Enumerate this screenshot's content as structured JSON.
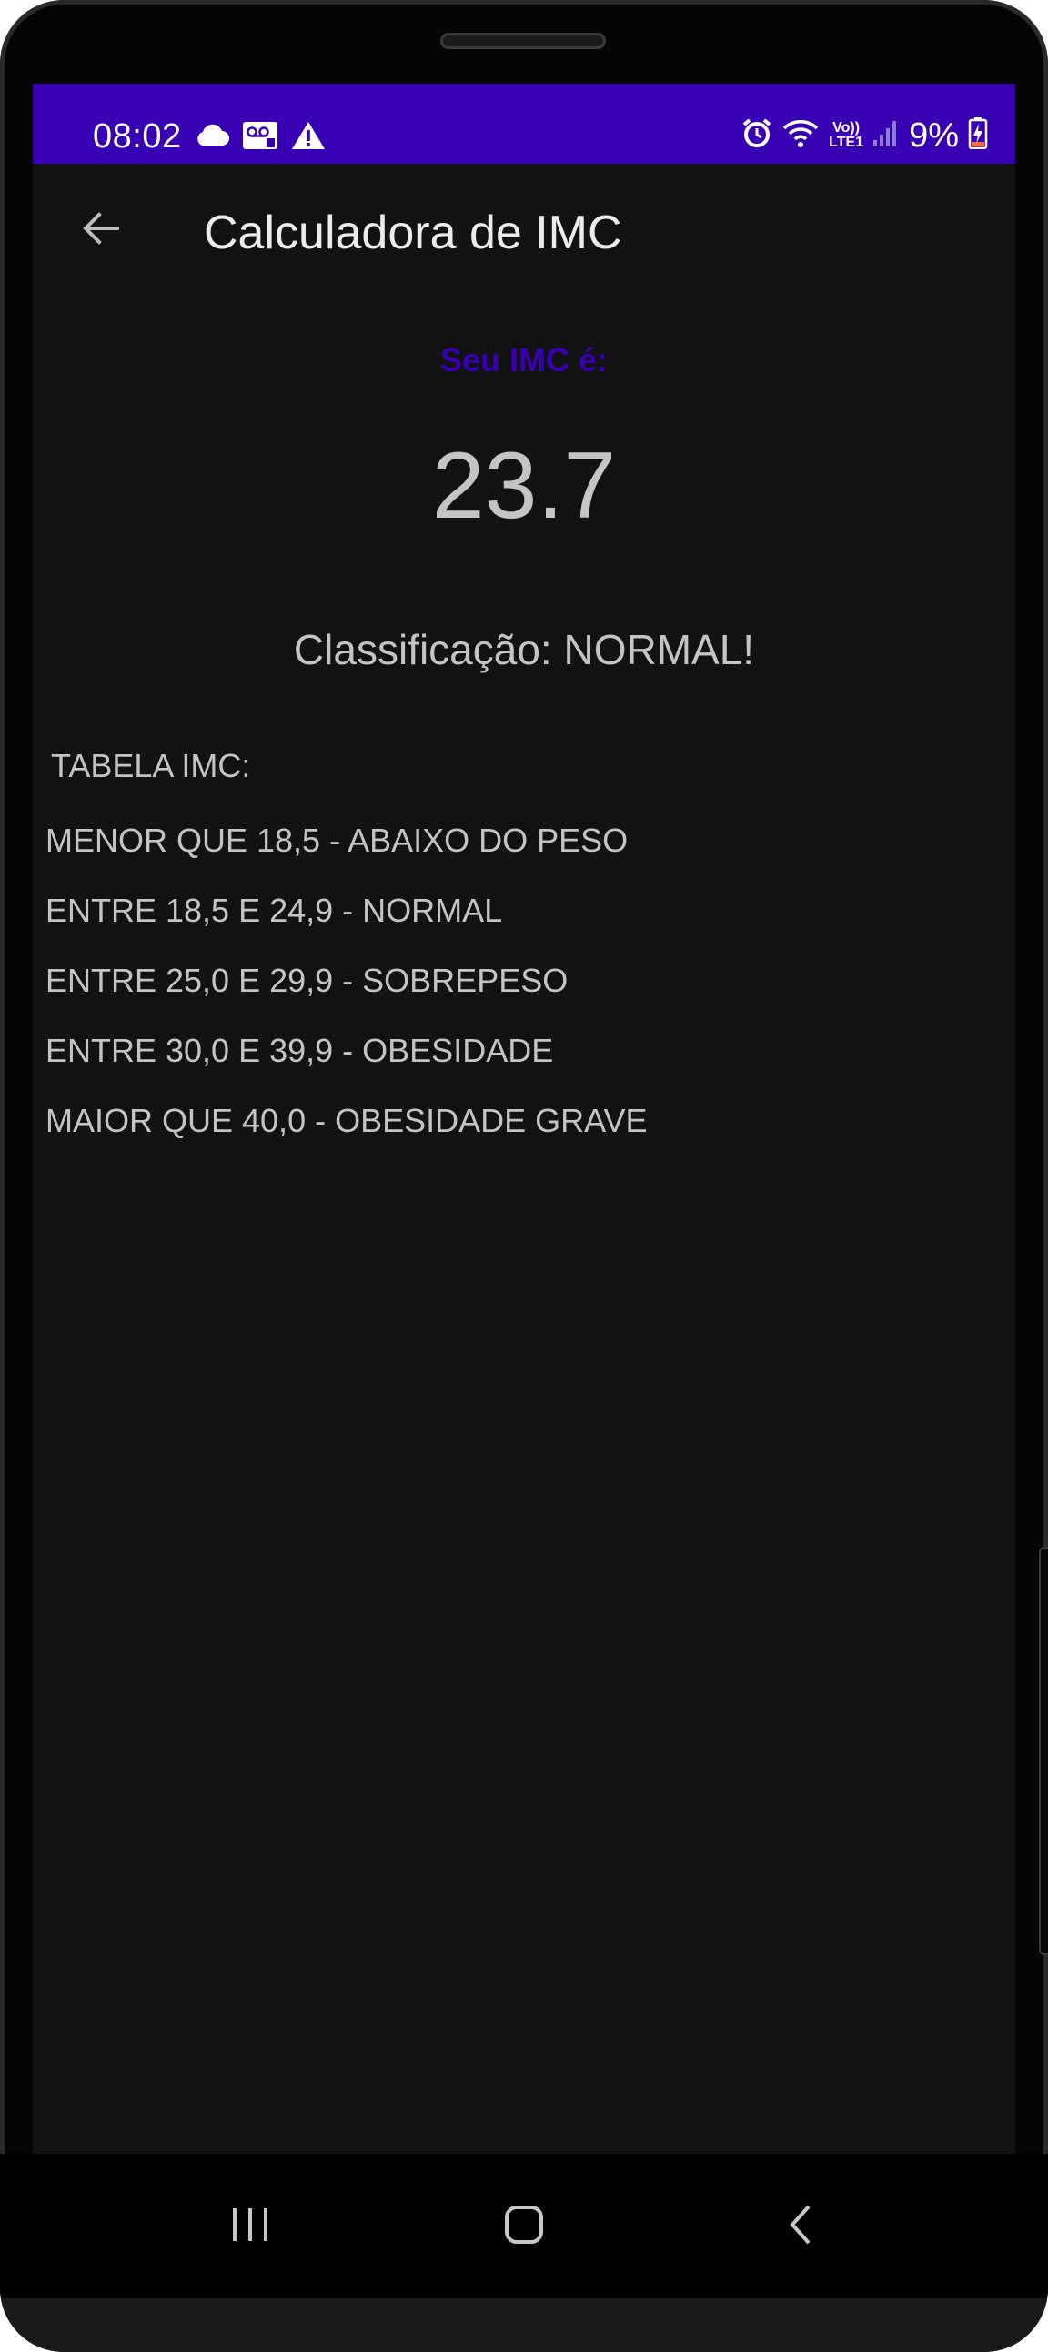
{
  "status_bar": {
    "time": "08:02",
    "battery": "9%",
    "network": "LTE1",
    "volte": "Vo))",
    "icons": [
      "cloud-icon",
      "voicemail-icon",
      "warning-icon",
      "alarm-icon",
      "wifi-icon",
      "signal-icon",
      "battery-charging-icon"
    ]
  },
  "app_bar": {
    "title": "Calculadora de IMC",
    "back_icon": "arrow-back-icon"
  },
  "result": {
    "label": "Seu IMC é:",
    "value": "23.7",
    "classification": "Classificação: NORMAL!"
  },
  "table": {
    "title": "TABELA IMC:",
    "rows": [
      "MENOR QUE 18,5 - ABAIXO DO PESO",
      "ENTRE 18,5 E 24,9 - NORMAL",
      "ENTRE 25,0 E 29,9 - SOBREPESO",
      "ENTRE 30,0 E 39,9 - OBESIDADE",
      "MAIOR QUE 40,0 - OBESIDADE GRAVE"
    ]
  },
  "nav_bar": {
    "icons": [
      "recent-apps-icon",
      "home-icon",
      "back-icon"
    ]
  },
  "colors": {
    "accent": "#3700b3",
    "background": "#121212",
    "text": "#c4c4c4",
    "title": "#ececec"
  }
}
